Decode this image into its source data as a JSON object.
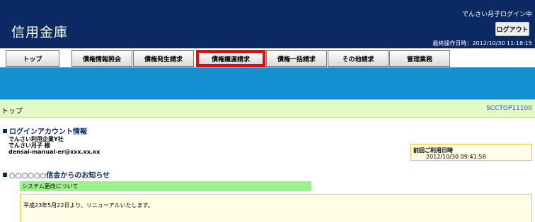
{
  "header": {
    "brand": "信用金庫",
    "user_name": "でんさい月子ログイン中",
    "logout_label": "ログアウト",
    "last_operation": "最終操作日時：2012/10/30 11:18:15"
  },
  "tabs": [
    {
      "label": "トップ"
    },
    {
      "label": "債権情報照会"
    },
    {
      "label": "債権発生請求"
    },
    {
      "label": "債権譲渡請求",
      "highlighted": true
    },
    {
      "label": "債権一括請求"
    },
    {
      "label": "その他請求"
    },
    {
      "label": "管理業務"
    }
  ],
  "page": {
    "title": "トップ",
    "screen_id": "SCCTOP11100"
  },
  "account": {
    "heading": "ログインアカウント情報",
    "company": "でんさい利用企業Y社",
    "user": "でんさい月子 様",
    "email": "densai-manual-er@xxx.xx.xx",
    "last_login_label": "前回ご利用日時",
    "last_login_value": "2012/10/30 09:41:58"
  },
  "notices": {
    "heading": "○○○○○○信金からのお知らせ",
    "item_title": "システム更改について",
    "item_body": "平成23年5月22日より、リニューアルいたします。"
  },
  "colors": {
    "header_bg": "#0b2a63",
    "band_blue": "#1490d2",
    "titlebar_bg": "#e5f9c6",
    "highlight_red": "#ff0000",
    "notice_green": "#9df28e",
    "notice_body_bg": "#fffde6"
  }
}
